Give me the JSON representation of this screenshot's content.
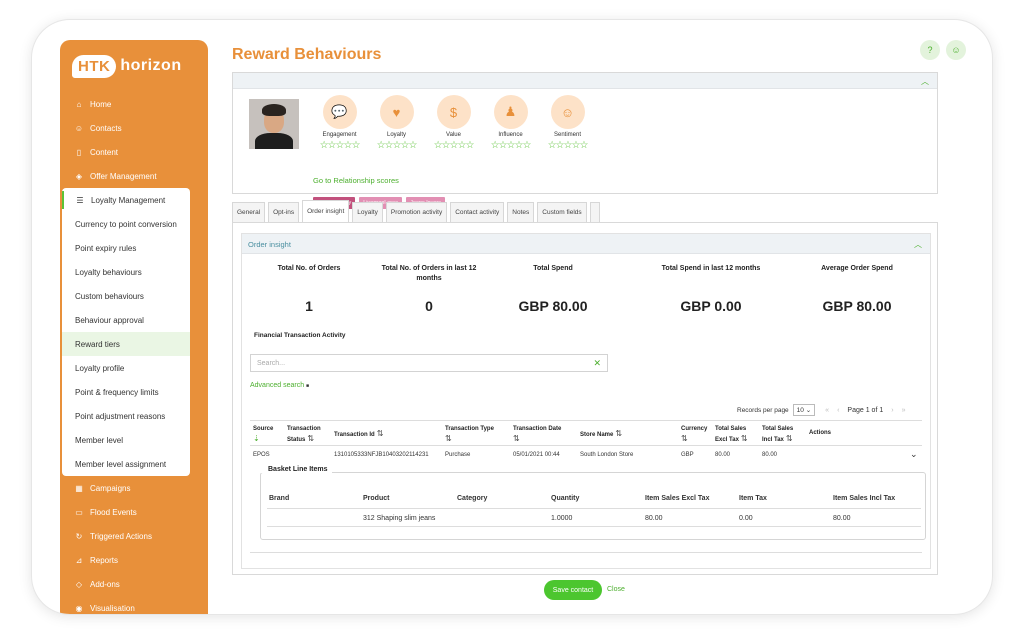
{
  "app": {
    "logo_badge": "HTK",
    "logo_text": "horizon"
  },
  "page": {
    "title": "Reward Behaviours"
  },
  "nav": {
    "items_top": [
      "Home",
      "Contacts",
      "Content",
      "Offer Management"
    ],
    "loyalty_head": "Loyalty Management",
    "loyalty_sub": [
      "Currency to point conversion",
      "Point expiry rules",
      "Loyalty behaviours",
      "Custom behaviours",
      "Behaviour approval",
      "Reward tiers",
      "Loyalty profile",
      "Point & frequency limits",
      "Point adjustment reasons",
      "Member level",
      "Member level assignment"
    ],
    "items_bottom": [
      "Campaigns",
      "Flood Events",
      "Triggered Actions",
      "Reports",
      "Add-ons",
      "Visualisation"
    ]
  },
  "profile": {
    "scores": [
      {
        "label": "Engagement",
        "stars": "☆☆☆☆☆"
      },
      {
        "label": "Loyalty",
        "stars": "☆☆☆☆☆"
      },
      {
        "label": "Value",
        "stars": "☆☆☆☆☆"
      },
      {
        "label": "Influence",
        "stars": "☆☆☆☆☆"
      },
      {
        "label": "Sentiment",
        "stars": "☆☆☆☆☆"
      }
    ],
    "relationship_link": "Go to Relationship scores",
    "tags": [
      {
        "label": "High Recency",
        "color": "#c2517d"
      },
      {
        "label": "Liverpool area",
        "color": "#e28fb3"
      },
      {
        "label": "Jeans lovers",
        "color": "#e28fb3"
      }
    ]
  },
  "tabs": [
    "General",
    "Opt-ins",
    "Order insight",
    "Loyalty",
    "Promotion activity",
    "Contact activity",
    "Notes",
    "Custom fields",
    ""
  ],
  "order_insight": {
    "title": "Order insight",
    "metrics": [
      {
        "label": "Total No. of Orders",
        "value": "1"
      },
      {
        "label": "Total No. of Orders in last 12 months",
        "value": "0"
      },
      {
        "label": "Total Spend",
        "value": "GBP 80.00"
      },
      {
        "label": "Total Spend in last 12 months",
        "value": "GBP 0.00"
      },
      {
        "label": "Average Order Spend",
        "value": "GBP 80.00"
      }
    ],
    "financial_title": "Financial Transaction Activity",
    "search_placeholder": "Search...",
    "advanced_search": "Advanced search",
    "records_per_page_label": "Records per page",
    "records_per_page_value": "10",
    "page_text": "Page 1 of 1",
    "columns": [
      "Source",
      "Transaction Status",
      "Transaction Id",
      "Transaction Type",
      "Transaction Date",
      "Store Name",
      "Currency",
      "Total Sales Excl Tax",
      "Total Sales Incl Tax",
      "Actions"
    ],
    "row": {
      "source": "EPOS",
      "status": "",
      "id": "1310105333NFJB10403202114231",
      "type": "Purchase",
      "date": "05/01/2021 00:44",
      "store": "South London Store",
      "currency": "GBP",
      "excl": "80.00",
      "incl": "80.00"
    },
    "basket": {
      "title": "Basket Line Items",
      "columns": [
        "Brand",
        "Product",
        "Category",
        "Quantity",
        "Item Sales Excl Tax",
        "Item Tax",
        "Item Sales Incl Tax"
      ],
      "row": [
        "",
        "312 Shaping slim jeans",
        "",
        "1.0000",
        "80.00",
        "0.00",
        "80.00"
      ]
    }
  },
  "footer": {
    "save": "Save contact",
    "close": "Close"
  }
}
